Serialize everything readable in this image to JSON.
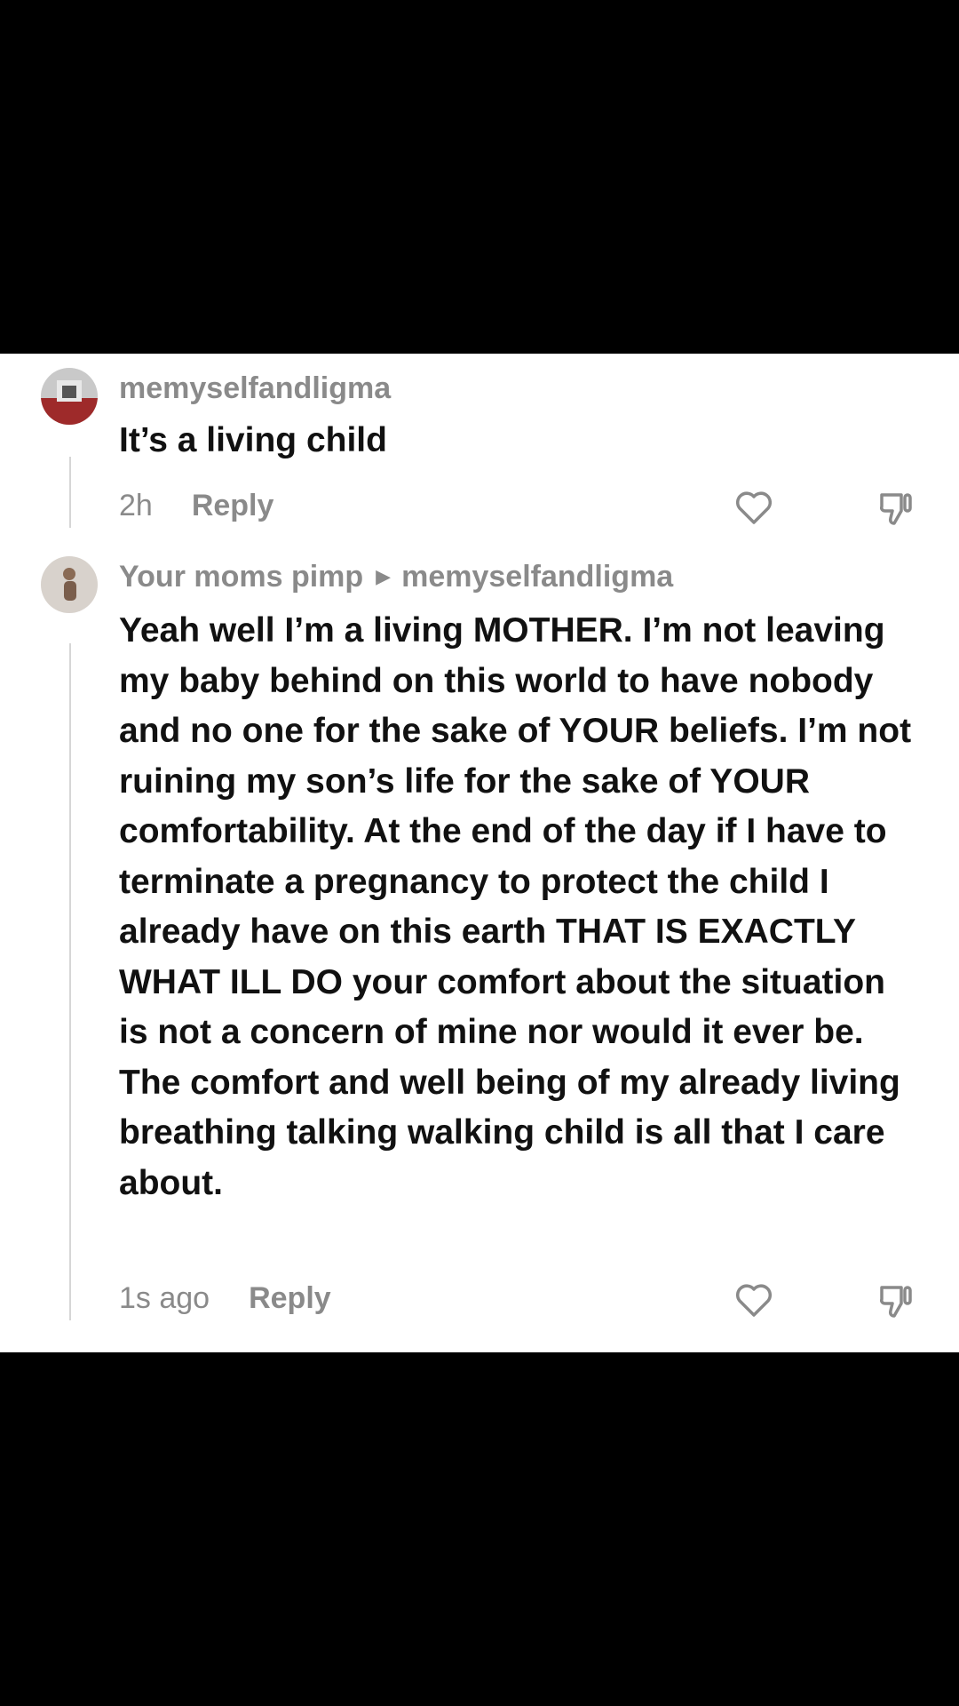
{
  "comments": [
    {
      "username": "memyselfandligma",
      "reply_to": "",
      "text": "It’s a living child",
      "time": "2h",
      "reply_label": "Reply",
      "icons": {
        "like": "heart-icon",
        "dislike": "thumbs-down-icon"
      }
    },
    {
      "username": "Your moms pimp",
      "reply_to": "memyselfandligma",
      "text": "Yeah well I’m a living MOTHER. I’m not leaving my baby behind on this world to have nobody and no one for the sake of YOUR beliefs. I’m not ruining my son’s life for the sake of YOUR comfortability. At the end of the day if I have to terminate a pregnancy to protect the child I already have on this earth THAT IS EXACTLY WHAT ILL DO your comfort about the situation is not a concern of mine nor would it ever be. The comfort and well being of my already living breathing talking walking child is all that I care about.",
      "time": "1s ago",
      "reply_label": "Reply",
      "icons": {
        "like": "heart-icon",
        "dislike": "thumbs-down-icon"
      }
    }
  ],
  "colors": {
    "background": "#000000",
    "panel": "#ffffff",
    "text": "#111111",
    "muted": "#8a8a8a"
  }
}
